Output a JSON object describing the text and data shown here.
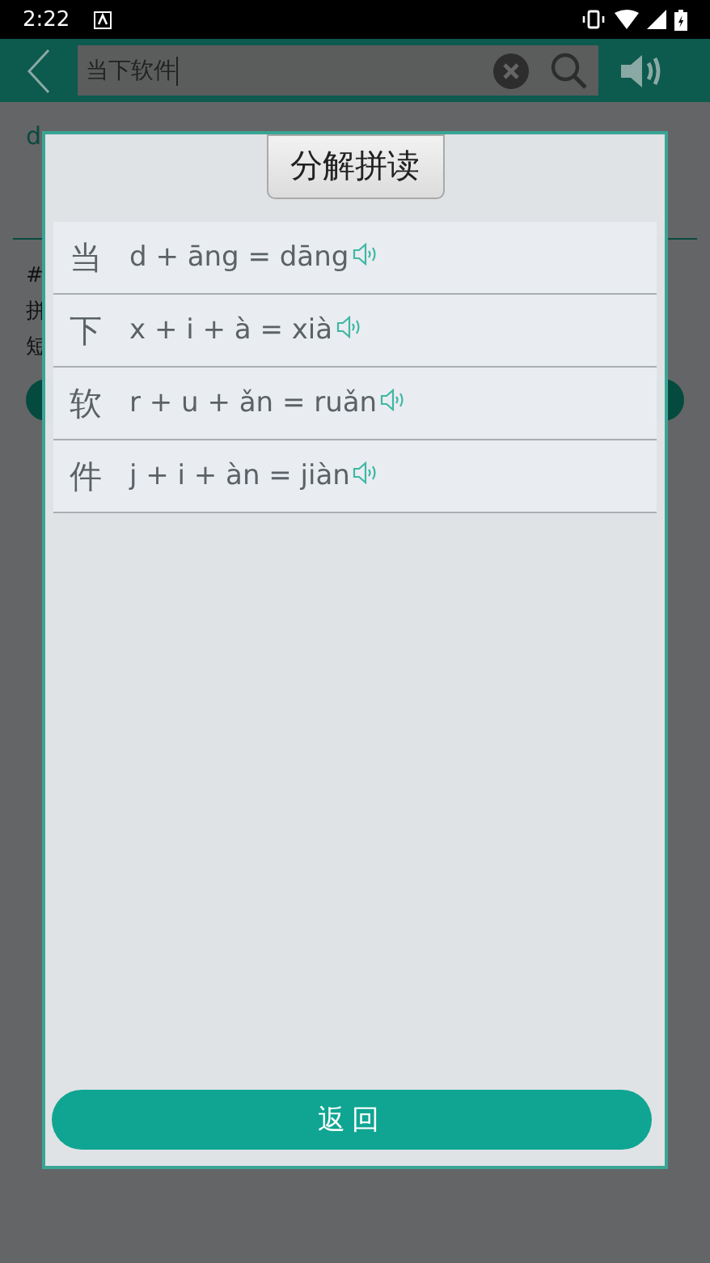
{
  "status_bar": {
    "time": "2:22"
  },
  "toolbar": {
    "search": {
      "value": "当下软件"
    }
  },
  "background": {
    "pinyin_fragment": "d",
    "line_fragments": [
      "#",
      "拼",
      "短"
    ]
  },
  "dialog": {
    "title": "分解拼读",
    "rows": [
      {
        "char": "当",
        "formula": "d + āng = dāng"
      },
      {
        "char": "下",
        "formula": "x + i + à = xià"
      },
      {
        "char": "软",
        "formula": "r + u + ǎn = ruǎn"
      },
      {
        "char": "件",
        "formula": "j + i + àn = jiàn"
      }
    ],
    "button": "返回"
  }
}
